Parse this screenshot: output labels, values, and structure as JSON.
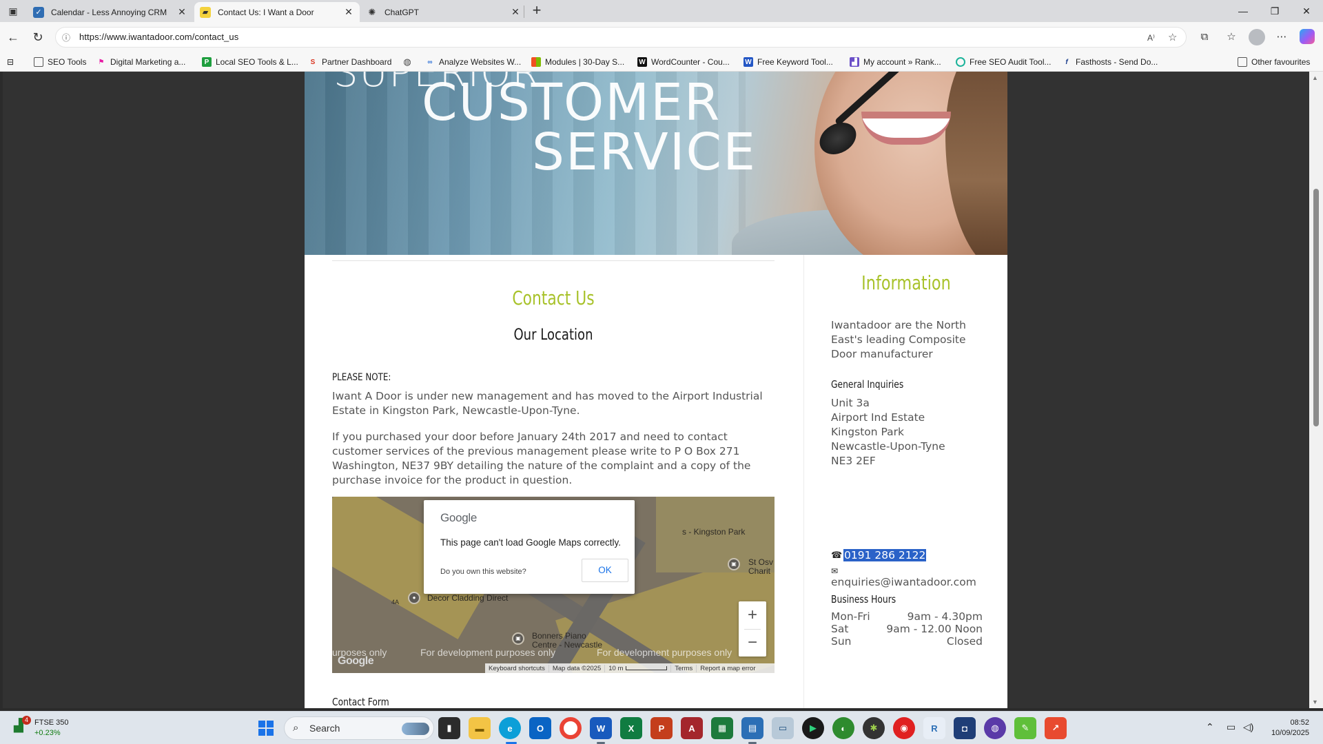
{
  "browser": {
    "tabs": [
      {
        "title": "Calendar - Less Annoying CRM",
        "icon": "crm-icon",
        "active": false
      },
      {
        "title": "Contact Us: I Want a Door",
        "icon": "door-icon",
        "active": true
      },
      {
        "title": "ChatGPT",
        "icon": "chatgpt-icon",
        "active": false
      }
    ],
    "url": "https://www.iwantadoor.com/contact_us",
    "favourites": [
      {
        "label": "SEO Tools",
        "icon": "folder-icon"
      },
      {
        "label": "Digital Marketing a...",
        "icon": "flag-icon"
      },
      {
        "label": "Local SEO Tools & L...",
        "icon": "localseo-icon"
      },
      {
        "label": "Partner Dashboard",
        "icon": "partner-icon"
      },
      {
        "label": "",
        "icon": "globe-icon"
      },
      {
        "label": "Analyze Websites W...",
        "icon": "analyze-icon"
      },
      {
        "label": "Modules | 30-Day S...",
        "icon": "ms-icon"
      },
      {
        "label": "WordCounter - Cou...",
        "icon": "wordcounter-icon"
      },
      {
        "label": "Free Keyword Tool...",
        "icon": "keyword-icon"
      },
      {
        "label": "My account » Rank...",
        "icon": "rank-icon"
      },
      {
        "label": "Free SEO Audit Tool...",
        "icon": "audit-icon"
      },
      {
        "label": "Fasthosts - Send Do...",
        "icon": "fasthosts-icon"
      }
    ],
    "other_favourites": "Other favourites"
  },
  "hero": {
    "line_top": "SUPERIOR",
    "line1": "CUSTOMER",
    "line2": "SERVICE"
  },
  "main": {
    "title": "Contact Us",
    "subtitle": "Our Location",
    "note_label": "PLEASE NOTE:",
    "para1": "Iwant A Door is under new management and has moved to the Airport Industrial Estate in Kingston Park, Newcastle-Upon-Tyne.",
    "para2": "If you purchased your door before January 24th 2017 and need to contact customer services of the previous management please write to P O Box 271 Washington, NE37 9BY detailing the nature of the complaint and a copy of the purchase invoice for the product in question.",
    "contact_form_heading": "Contact Form"
  },
  "map": {
    "labels": {
      "kingston": "s - Kingston Park",
      "st_os": "St Osv",
      "charit": "Charit",
      "decor": "Decor Cladding Direct",
      "unit": "4A",
      "bonners1": "Bonners Piano",
      "bonners2": "Centre - Newcastle"
    },
    "dev_text": [
      "urposes only",
      "For development purposes only",
      "For development purposes only"
    ],
    "logo": "Google",
    "zoom_in": "+",
    "zoom_out": "−",
    "footer": {
      "shortcuts": "Keyboard shortcuts",
      "data": "Map data ©2025",
      "scale": "10 m",
      "terms": "Terms",
      "report": "Report a map error"
    },
    "dialog": {
      "logo": "Google",
      "message": "This page can't load Google Maps correctly.",
      "question": "Do you own this website?",
      "ok": "OK"
    }
  },
  "sidebar": {
    "title": "Information",
    "intro": "Iwantadoor are the North East's leading Composite Door manufacturer",
    "general_heading": "General Inquiries",
    "address": [
      "Unit 3a",
      "Airport Ind Estate",
      "Kingston Park",
      "Newcastle-Upon-Tyne",
      "NE3 2EF"
    ],
    "phone": "0191 286 2122",
    "email": "enquiries@iwantadoor.com",
    "hours_heading": "Business Hours",
    "hours": [
      {
        "day": "Mon-Fri",
        "time": "9am - 4.30pm"
      },
      {
        "day": "Sat",
        "time": "9am - 12.00 Noon"
      },
      {
        "day": "Sun",
        "time": "Closed"
      }
    ]
  },
  "taskbar": {
    "widget_name": "FTSE 350",
    "widget_value": "+0.23%",
    "widget_badge": "4",
    "search_placeholder": "Search",
    "time": "08:52",
    "date": "10/09/2025"
  },
  "colors": {
    "accent_green": "#a8c22a",
    "selection_blue": "#2a62c8",
    "map_ok_blue": "#1a73e8"
  }
}
